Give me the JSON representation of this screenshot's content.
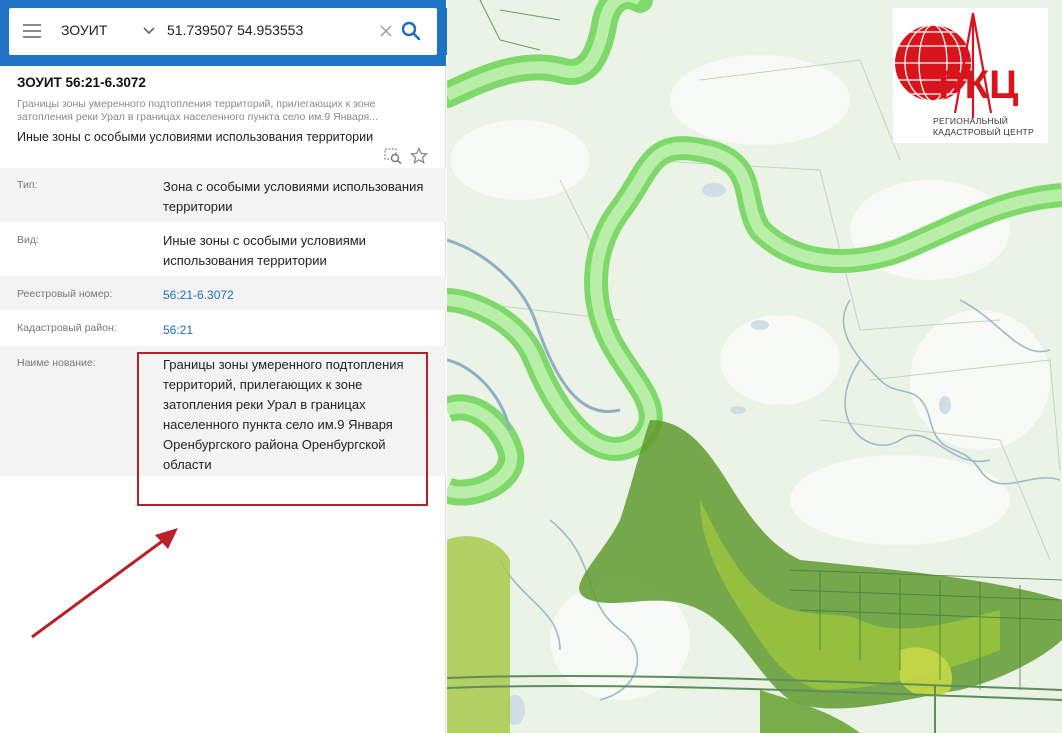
{
  "search": {
    "layer": "ЗОУИТ",
    "query": "51.739507 54.953553"
  },
  "object": {
    "title": "ЗОУИТ 56:21-6.3072",
    "subtitle": "Границы зоны умеренного подтопления территорий, прилегающих к зоне затопления реки Урал в границах населенного пункта село им.9 Января...",
    "category": "Иные зоны с особыми условиями использования территории"
  },
  "attributes": [
    {
      "label": "Тип:",
      "value": "Зона с особыми условиями использования территории"
    },
    {
      "label": "Вид:",
      "value": "Иные зоны с особыми условиями использования территории"
    },
    {
      "label": "Реестровый номер:",
      "value": "56:21-6.3072"
    },
    {
      "label": "Кадастровый район:",
      "value": "56:21"
    },
    {
      "label": "Наиме нование:",
      "value": "Границы зоны умеренного подтопления территорий, прилегающих к зоне затопления реки Урал в границах населенного пункта село им.9 Января Оренбургского района Оренбургской области"
    }
  ],
  "logo": {
    "abbr": "РКЦ",
    "line1": "Региональный",
    "line2": "кадастровый центр"
  },
  "colors": {
    "header": "#1e73c4",
    "link": "#1e6db8",
    "highlight": "#b8212a",
    "river_zone": "#8ee07a",
    "flood_zone": "#5f9a2e",
    "logo_red": "#d8141c"
  },
  "icons": [
    "menu-icon",
    "chevron-down-icon",
    "clear-icon",
    "search-icon",
    "collapse-icon",
    "zoom-to-icon",
    "star-icon"
  ]
}
